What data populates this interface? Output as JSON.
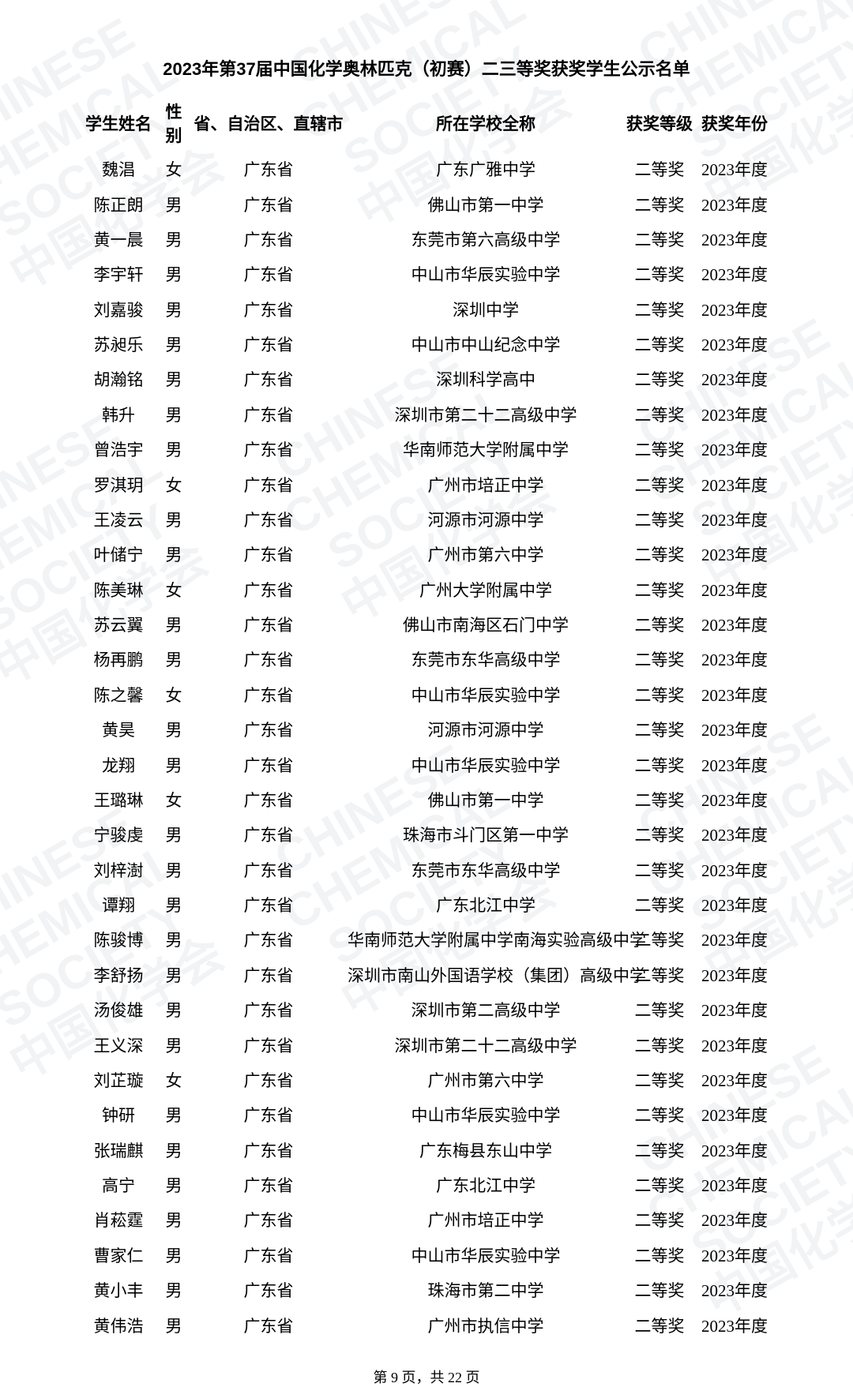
{
  "title": "2023年第37届中国化学奥林匹克（初赛）二三等奖获奖学生公示名单",
  "headers": {
    "name": "学生姓名",
    "gender": "性别",
    "province": "省、自治区、直辖市",
    "school": "所在学校全称",
    "level": "获奖等级",
    "year": "获奖年份"
  },
  "rows": [
    {
      "name": "魏淐",
      "gender": "女",
      "province": "广东省",
      "school": "广东广雅中学",
      "level": "二等奖",
      "year": "2023年度"
    },
    {
      "name": "陈正朗",
      "gender": "男",
      "province": "广东省",
      "school": "佛山市第一中学",
      "level": "二等奖",
      "year": "2023年度"
    },
    {
      "name": "黄一晨",
      "gender": "男",
      "province": "广东省",
      "school": "东莞市第六高级中学",
      "level": "二等奖",
      "year": "2023年度"
    },
    {
      "name": "李宇轩",
      "gender": "男",
      "province": "广东省",
      "school": "中山市华辰实验中学",
      "level": "二等奖",
      "year": "2023年度"
    },
    {
      "name": "刘嘉骏",
      "gender": "男",
      "province": "广东省",
      "school": "深圳中学",
      "level": "二等奖",
      "year": "2023年度"
    },
    {
      "name": "苏昶乐",
      "gender": "男",
      "province": "广东省",
      "school": "中山市中山纪念中学",
      "level": "二等奖",
      "year": "2023年度"
    },
    {
      "name": "胡瀚铭",
      "gender": "男",
      "province": "广东省",
      "school": "深圳科学高中",
      "level": "二等奖",
      "year": "2023年度"
    },
    {
      "name": "韩升",
      "gender": "男",
      "province": "广东省",
      "school": "深圳市第二十二高级中学",
      "level": "二等奖",
      "year": "2023年度"
    },
    {
      "name": "曾浩宇",
      "gender": "男",
      "province": "广东省",
      "school": "华南师范大学附属中学",
      "level": "二等奖",
      "year": "2023年度"
    },
    {
      "name": "罗淇玥",
      "gender": "女",
      "province": "广东省",
      "school": "广州市培正中学",
      "level": "二等奖",
      "year": "2023年度"
    },
    {
      "name": "王凌云",
      "gender": "男",
      "province": "广东省",
      "school": "河源市河源中学",
      "level": "二等奖",
      "year": "2023年度"
    },
    {
      "name": "叶储宁",
      "gender": "男",
      "province": "广东省",
      "school": "广州市第六中学",
      "level": "二等奖",
      "year": "2023年度"
    },
    {
      "name": "陈美琳",
      "gender": "女",
      "province": "广东省",
      "school": "广州大学附属中学",
      "level": "二等奖",
      "year": "2023年度"
    },
    {
      "name": "苏云翼",
      "gender": "男",
      "province": "广东省",
      "school": "佛山市南海区石门中学",
      "level": "二等奖",
      "year": "2023年度"
    },
    {
      "name": "杨再鹏",
      "gender": "男",
      "province": "广东省",
      "school": "东莞市东华高级中学",
      "level": "二等奖",
      "year": "2023年度"
    },
    {
      "name": "陈之馨",
      "gender": "女",
      "province": "广东省",
      "school": "中山市华辰实验中学",
      "level": "二等奖",
      "year": "2023年度"
    },
    {
      "name": "黄昊",
      "gender": "男",
      "province": "广东省",
      "school": "河源市河源中学",
      "level": "二等奖",
      "year": "2023年度"
    },
    {
      "name": "龙翔",
      "gender": "男",
      "province": "广东省",
      "school": "中山市华辰实验中学",
      "level": "二等奖",
      "year": "2023年度"
    },
    {
      "name": "王璐琳",
      "gender": "女",
      "province": "广东省",
      "school": "佛山市第一中学",
      "level": "二等奖",
      "year": "2023年度"
    },
    {
      "name": "宁骏虔",
      "gender": "男",
      "province": "广东省",
      "school": "珠海市斗门区第一中学",
      "level": "二等奖",
      "year": "2023年度"
    },
    {
      "name": "刘梓澍",
      "gender": "男",
      "province": "广东省",
      "school": "东莞市东华高级中学",
      "level": "二等奖",
      "year": "2023年度"
    },
    {
      "name": "谭翔",
      "gender": "男",
      "province": "广东省",
      "school": "广东北江中学",
      "level": "二等奖",
      "year": "2023年度"
    },
    {
      "name": "陈骏博",
      "gender": "男",
      "province": "广东省",
      "school": "华南师范大学附属中学南海实验高级中学",
      "level": "二等奖",
      "year": "2023年度"
    },
    {
      "name": "李舒扬",
      "gender": "男",
      "province": "广东省",
      "school": "深圳市南山外国语学校（集团）高级中学",
      "level": "二等奖",
      "year": "2023年度"
    },
    {
      "name": "汤俊雄",
      "gender": "男",
      "province": "广东省",
      "school": "深圳市第二高级中学",
      "level": "二等奖",
      "year": "2023年度"
    },
    {
      "name": "王义深",
      "gender": "男",
      "province": "广东省",
      "school": "深圳市第二十二高级中学",
      "level": "二等奖",
      "year": "2023年度"
    },
    {
      "name": "刘芷璇",
      "gender": "女",
      "province": "广东省",
      "school": "广州市第六中学",
      "level": "二等奖",
      "year": "2023年度"
    },
    {
      "name": "钟研",
      "gender": "男",
      "province": "广东省",
      "school": "中山市华辰实验中学",
      "level": "二等奖",
      "year": "2023年度"
    },
    {
      "name": "张瑞麒",
      "gender": "男",
      "province": "广东省",
      "school": "广东梅县东山中学",
      "level": "二等奖",
      "year": "2023年度"
    },
    {
      "name": "高宁",
      "gender": "男",
      "province": "广东省",
      "school": "广东北江中学",
      "level": "二等奖",
      "year": "2023年度"
    },
    {
      "name": "肖菘霆",
      "gender": "男",
      "province": "广东省",
      "school": "广州市培正中学",
      "level": "二等奖",
      "year": "2023年度"
    },
    {
      "name": "曹家仁",
      "gender": "男",
      "province": "广东省",
      "school": "中山市华辰实验中学",
      "level": "二等奖",
      "year": "2023年度"
    },
    {
      "name": "黄小丰",
      "gender": "男",
      "province": "广东省",
      "school": "珠海市第二中学",
      "level": "二等奖",
      "year": "2023年度"
    },
    {
      "name": "黄伟浩",
      "gender": "男",
      "province": "广东省",
      "school": "广州市执信中学",
      "level": "二等奖",
      "year": "2023年度"
    }
  ],
  "pager": "第 9 页，共 22 页",
  "watermark_lines": "CHINESE\nCHEMICAL\nSOCIETY\n中国化学会"
}
